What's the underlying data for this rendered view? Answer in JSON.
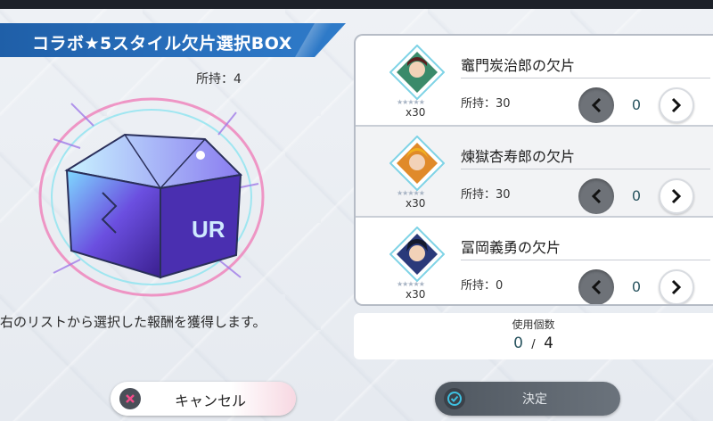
{
  "dialog": {
    "title": "コラボ★5スタイル欠片選択BOX",
    "held": "所持：4",
    "description": "右のリストから選択した報酬を獲得します。"
  },
  "items": [
    {
      "name": "竈門炭治郎の欠片",
      "stars": "★★★★★",
      "count": "x30",
      "held": "所持：30",
      "qty": "0",
      "portrait_accent": "#3a8a6a"
    },
    {
      "name": "煉獄杏寿郎の欠片",
      "stars": "★★★★★",
      "count": "x30",
      "held": "所持：30",
      "qty": "0",
      "portrait_accent": "#e08a2a"
    },
    {
      "name": "冨岡義勇の欠片",
      "stars": "★★★★★",
      "count": "x30",
      "held": "所持：0",
      "qty": "0",
      "portrait_accent": "#2a3a7a"
    }
  ],
  "usage": {
    "label": "使用個数",
    "used": "0",
    "separator": "/",
    "max": "4"
  },
  "buttons": {
    "cancel": "キャンセル",
    "confirm": "決定"
  },
  "colors": {
    "title_bar": "#2b74c2",
    "accent_teal": "#2a5560",
    "button_dark": "#6e7278"
  }
}
